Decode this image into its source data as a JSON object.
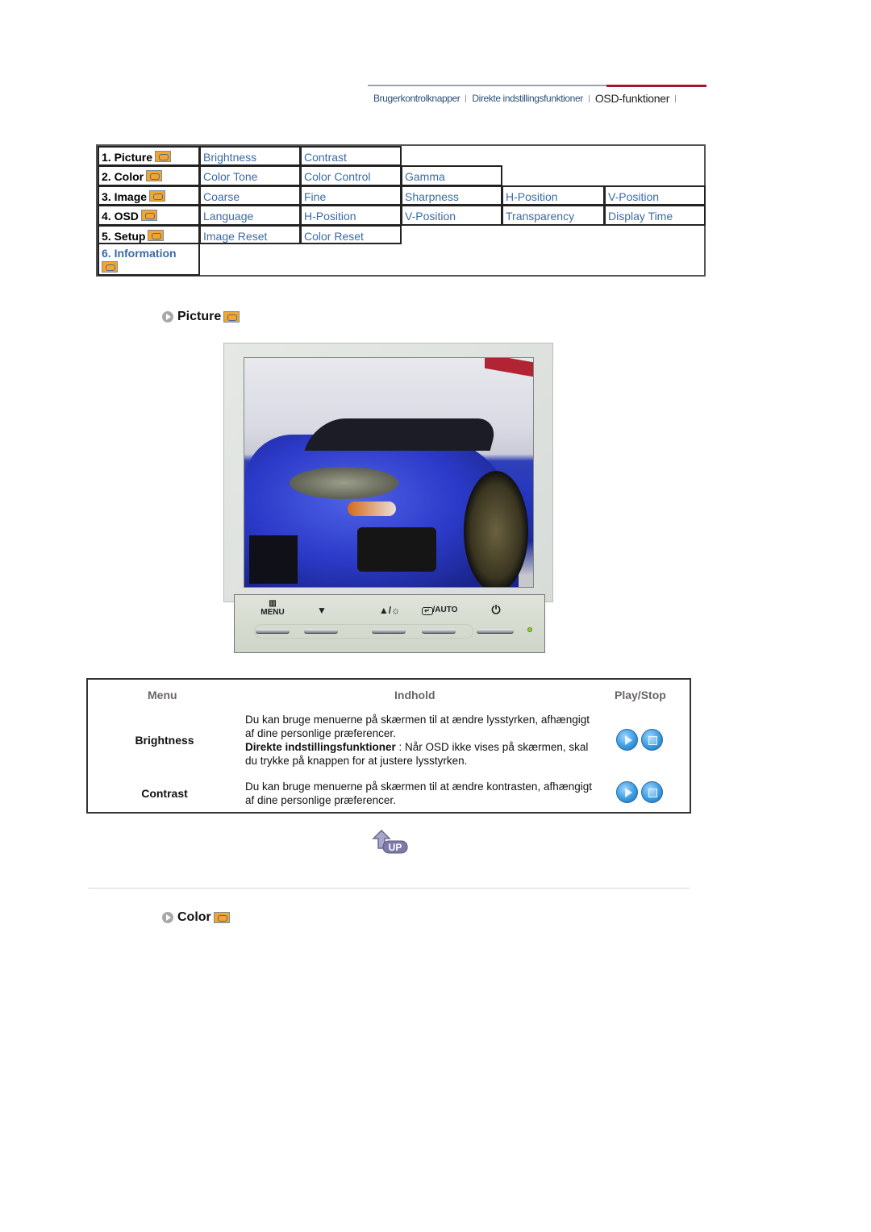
{
  "topnav": {
    "links": [
      "Brugerkontrolknapper",
      "Direkte indstillingsfunktioner",
      "OSD-funktioner"
    ],
    "active_index": 2
  },
  "menu": {
    "rows": [
      {
        "label": "1. Picture",
        "icon": "picture-icon",
        "items": [
          "Brightness",
          "Contrast"
        ]
      },
      {
        "label": "2. Color",
        "icon": "color-icon",
        "items": [
          "Color Tone",
          "Color Control",
          "Gamma"
        ]
      },
      {
        "label": "3. Image",
        "icon": "image-icon",
        "items": [
          "Coarse",
          "Fine",
          "Sharpness",
          "H-Position",
          "V-Position"
        ]
      },
      {
        "label": "4. OSD",
        "icon": "osd-icon",
        "items": [
          "Language",
          "H-Position",
          "V-Position",
          "Transparency",
          "Display Time"
        ]
      },
      {
        "label": "5. Setup",
        "icon": "setup-icon",
        "items": [
          "Image Reset",
          "Color Reset"
        ]
      },
      {
        "label": "6. Information",
        "icon": "information-icon",
        "items": []
      }
    ]
  },
  "picture_section": {
    "title": "Picture",
    "panel_buttons": {
      "menu": "MENU",
      "down": "▼",
      "up_brightness": "▲/☼",
      "enter_auto": "/AUTO",
      "power": "⏻"
    }
  },
  "info_table": {
    "headers": [
      "Menu",
      "Indhold",
      "Play/Stop"
    ],
    "rows": [
      {
        "menu": "Brightness",
        "text": "Du kan bruge menuerne på skærmen til at ændre lysstyrken, afhængigt af dine personlige præferencer.",
        "bold": "Direkte indstillingsfunktioner",
        "text2": " : Når OSD ikke vises på skærmen, skal du trykke på knappen for at justere lysstyrken."
      },
      {
        "menu": "Contrast",
        "text": "Du kan bruge menuerne på skærmen til at ændre kontrasten, afhængigt af dine personlige præferencer."
      }
    ]
  },
  "up_label": "UP",
  "color_section": {
    "title": "Color"
  },
  "colors": {
    "link": "#3a6aa6",
    "accent_red": "#a3162b",
    "nav_text": "#2b5178"
  }
}
